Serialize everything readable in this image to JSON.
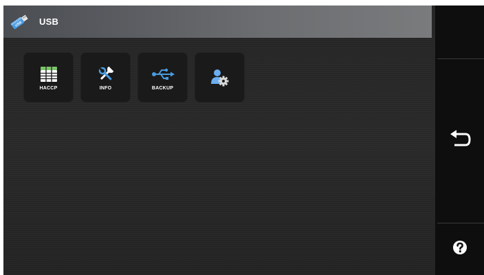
{
  "header": {
    "title": "USB",
    "icon": "usb-stick-icon"
  },
  "tiles": [
    {
      "label": "HACCP",
      "icon": "haccp-table-icon"
    },
    {
      "label": "INFO",
      "icon": "tools-icon"
    },
    {
      "label": "BACKUP",
      "icon": "usb-symbol-icon"
    },
    {
      "label": "",
      "icon": "user-settings-icon"
    }
  ],
  "sidebar": {
    "buttons": [
      {
        "name": "empty-slot",
        "icon": ""
      },
      {
        "name": "back",
        "icon": "back-arrow-icon"
      },
      {
        "name": "help",
        "icon": "help-icon"
      }
    ]
  },
  "colors": {
    "accent_blue": "#4a9be0",
    "accent_green": "#7cc46a",
    "background": "#262626",
    "sidebar": "#0e0e0e"
  }
}
